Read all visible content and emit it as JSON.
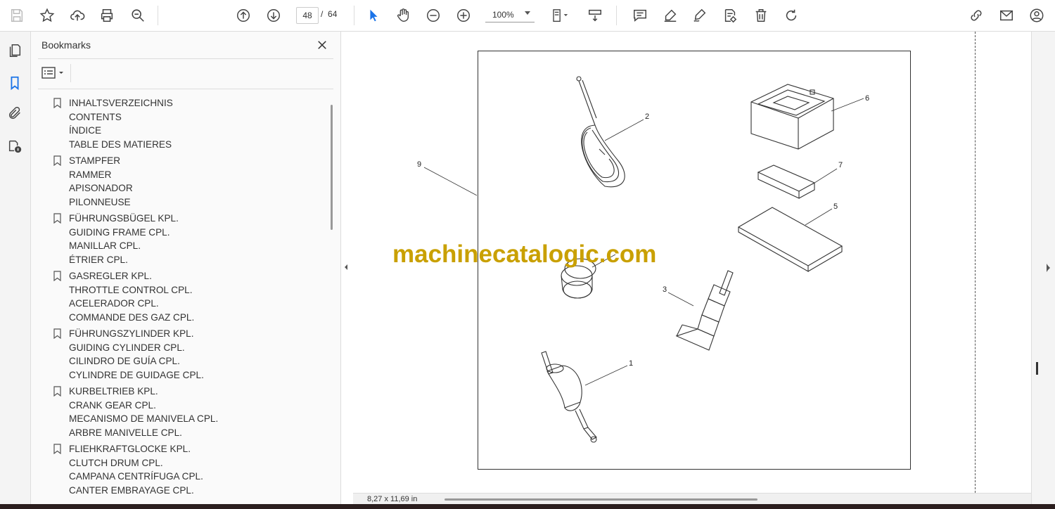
{
  "toolbar": {
    "page_current": "48",
    "page_sep": "/",
    "page_total": "64",
    "zoom": "100%",
    "icons": [
      "save-icon",
      "star-icon",
      "upload-icon",
      "print-icon",
      "zoom-search-icon",
      "page-up-icon",
      "page-down-icon",
      "select-arrow-icon",
      "hand-icon",
      "zoom-out-icon",
      "zoom-in-icon",
      "fit-page-icon",
      "scroll-mode-icon",
      "comment-icon",
      "highlight-icon",
      "sign-icon",
      "edit-text-icon",
      "delete-icon",
      "rotate-icon",
      "link-icon",
      "mail-icon",
      "account-icon"
    ]
  },
  "panel": {
    "title": "Bookmarks",
    "bookmarks": [
      {
        "line1": "INHALTSVERZEICHNIS",
        "line2": "CONTENTS",
        "line3": "ÍNDICE",
        "line4": "TABLE DES MATIERES"
      },
      {
        "line1": "STAMPFER",
        "line2": "RAMMER",
        "line3": "APISONADOR",
        "line4": "PILONNEUSE"
      },
      {
        "line1": "FÜHRUNGSBÜGEL KPL.",
        "line2": "GUIDING FRAME CPL.",
        "line3": "MANILLAR CPL.",
        "line4": "ÉTRIER CPL."
      },
      {
        "line1": "GASREGLER KPL.",
        "line2": "THROTTLE CONTROL CPL.",
        "line3": "ACELERADOR CPL.",
        "line4": "COMMANDE DES GAZ CPL."
      },
      {
        "line1": "FÜHRUNGSZYLINDER KPL.",
        "line2": "GUIDING CYLINDER CPL.",
        "line3": "CILINDRO DE GUÍA CPL.",
        "line4": "CYLINDRE DE GUIDAGE CPL."
      },
      {
        "line1": "KURBELTRIEB KPL.",
        "line2": "CRANK GEAR CPL.",
        "line3": "MECANISMO DE MANIVELA CPL.",
        "line4": "ARBRE MANIVELLE CPL."
      },
      {
        "line1": "FLIEHKRAFTGLOCKE KPL.",
        "line2": "CLUTCH DRUM CPL.",
        "line3": "CAMPANA CENTRÍFUGA CPL.",
        "line4": "CANTER EMBRAYAGE CPL."
      }
    ]
  },
  "document": {
    "callouts": {
      "c1": "1",
      "c2": "2",
      "c3": "3",
      "c5": "5",
      "c6": "6",
      "c7": "7",
      "c9": "9"
    },
    "watermark": "machinecatalogic.com"
  },
  "status": {
    "page_size": "8,27 x 11,69 in"
  },
  "colors": {
    "accent": "#1a73e8",
    "watermark": "#c9a000"
  }
}
